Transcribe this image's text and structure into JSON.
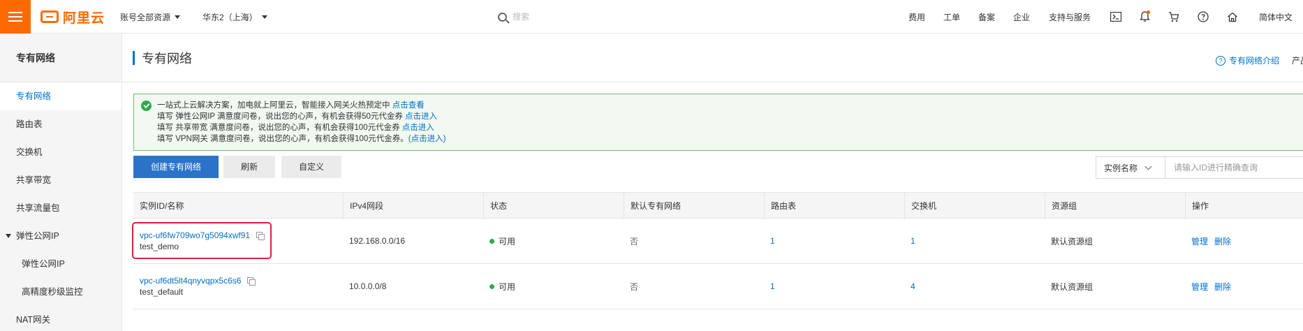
{
  "topbar": {
    "logo_text": "阿里云",
    "account_scope": "账号全部资源",
    "region": "华东2（上海）",
    "search_placeholder": "搜索",
    "links": [
      "费用",
      "工单",
      "备案",
      "企业",
      "支持与服务"
    ],
    "language": "简体中文",
    "icons": [
      "terminal-icon",
      "bell-icon",
      "cart-icon",
      "help-icon",
      "home-icon"
    ]
  },
  "sidebar": {
    "title": "专有网络",
    "items": [
      {
        "label": "专有网络",
        "active": true
      },
      {
        "label": "路由表"
      },
      {
        "label": "交换机"
      },
      {
        "label": "共享带宽"
      },
      {
        "label": "共享流量包"
      },
      {
        "label": "弹性公网IP",
        "expanded": true
      },
      {
        "label": "弹性公网IP",
        "sub": true
      },
      {
        "label": "高精度秒级监控",
        "sub": true
      },
      {
        "label": "NAT网关"
      }
    ]
  },
  "main": {
    "page_title": "专有网络",
    "intro_link": "专有网络介绍",
    "product_link": "产品",
    "notice": {
      "line1_text": "一站式上云解决方案，加电就上阿里云，智能接入网关火热预定中 ",
      "line1_link": "点击查看",
      "line2_text": "填写 弹性公网IP 满意度问卷，说出您的心声，有机会获得50元代金券 ",
      "line2_link": "点击进入",
      "line3_text": "填写 共享带宽 满意度问卷，说出您的心声，有机会获得100元代金券 ",
      "line3_link": "点击进入",
      "line4_text": "填写 VPN网关 满意度问卷，说出您的心声，有机会获得100元代金券。",
      "line4_link": "(点击进入)"
    },
    "toolbar": {
      "create_label": "创建专有网络",
      "refresh_label": "刷新",
      "customize_label": "自定义",
      "filter_select": "实例名称",
      "filter_placeholder": "请输入ID进行精确查询"
    },
    "table": {
      "headers": [
        "实例ID/名称",
        "IPv4网段",
        "状态",
        "默认专有网络",
        "路由表",
        "交换机",
        "资源组",
        "操作"
      ],
      "rows": [
        {
          "id": "vpc-uf6fw709wo7g5094xwf91",
          "name": "test_demo",
          "cidr": "192.168.0.0/16",
          "status": "可用",
          "default": "否",
          "route_tables": "1",
          "vswitches": "1",
          "resource_group": "默认资源组",
          "op_manage": "管理",
          "op_delete": "删除"
        },
        {
          "id": "vpc-uf6dt5lt4qnyvqpx5c6s6",
          "name": "test_default",
          "cidr": "10.0.0.0/8",
          "status": "可用",
          "default": "否",
          "route_tables": "1",
          "vswitches": "4",
          "resource_group": "默认资源组",
          "op_manage": "管理",
          "op_delete": "删除"
        }
      ]
    }
  },
  "colors": {
    "brand": "#ff6a00",
    "link": "#0070cc",
    "primary_button": "#2b73c9",
    "status_ok": "#2bab47",
    "highlight": "#e0203a"
  }
}
